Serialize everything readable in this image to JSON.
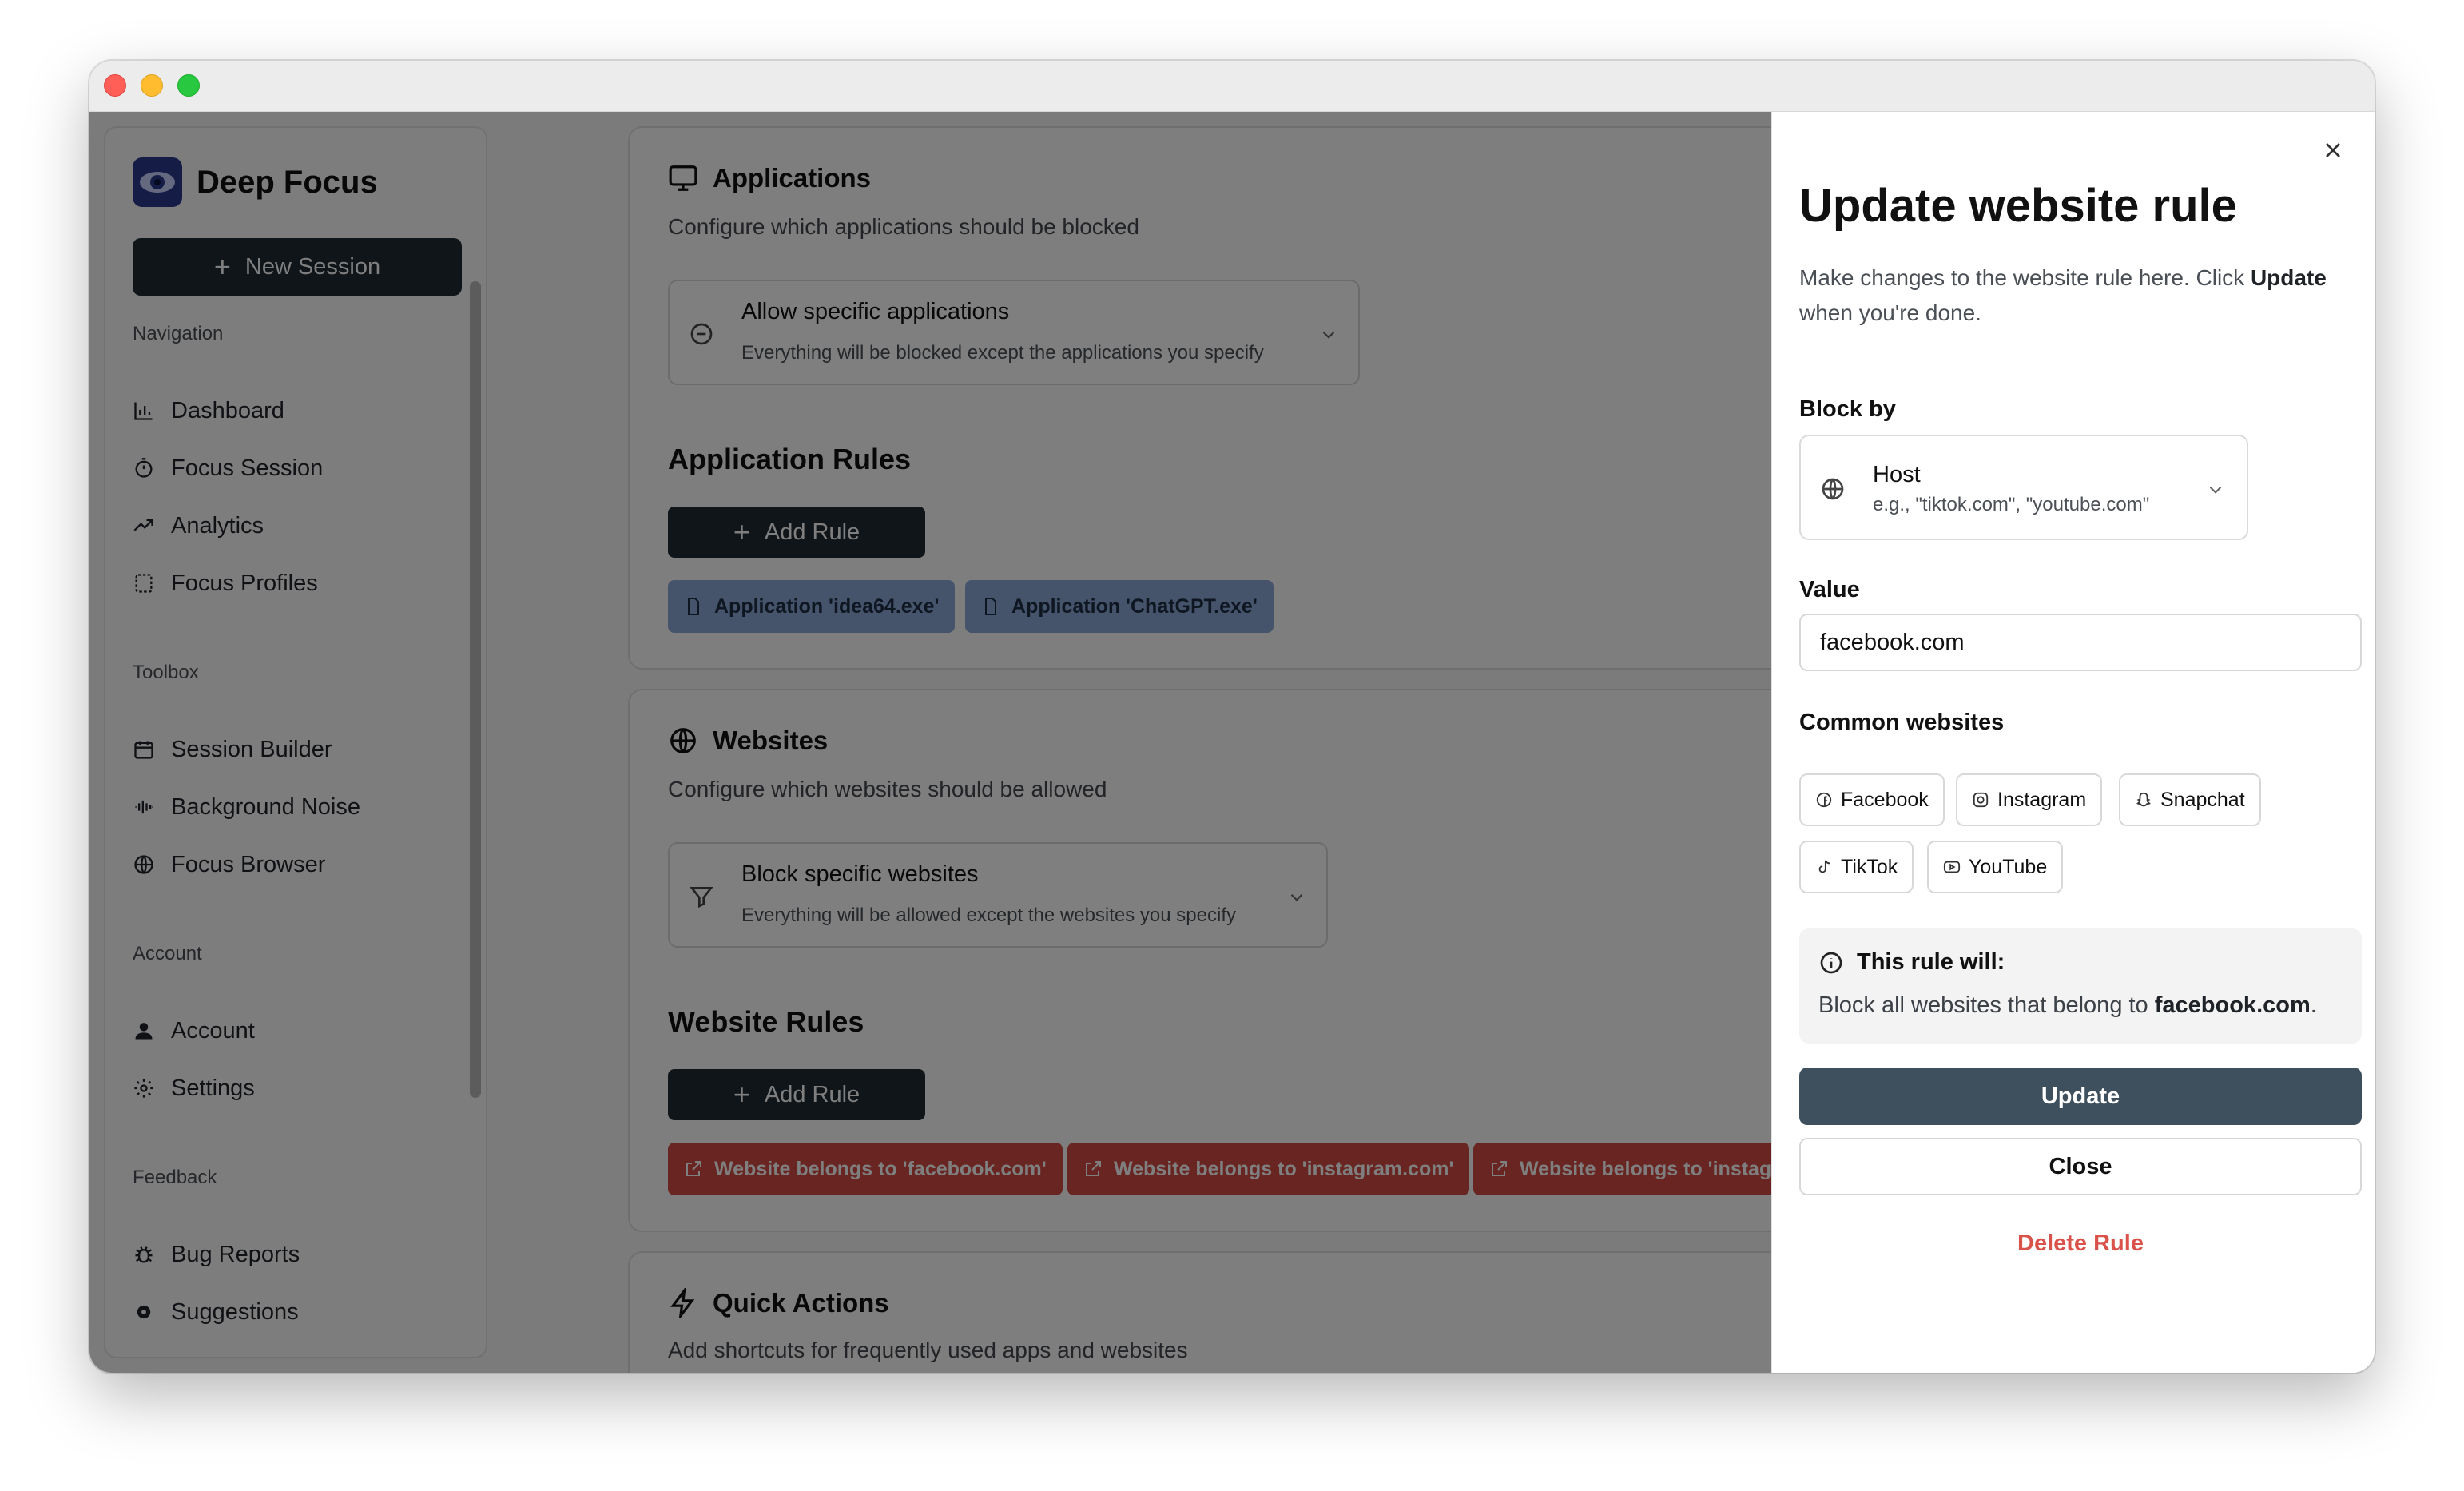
{
  "sidebar": {
    "brand": "Deep Focus",
    "new_session": "New Session",
    "sections": {
      "navigation": "Navigation",
      "toolbox": "Toolbox",
      "account": "Account",
      "feedback": "Feedback"
    },
    "items": {
      "dashboard": "Dashboard",
      "focus_session": "Focus Session",
      "analytics": "Analytics",
      "focus_profiles": "Focus Profiles",
      "session_builder": "Session Builder",
      "background_noise": "Background Noise",
      "focus_browser": "Focus Browser",
      "account": "Account",
      "settings": "Settings",
      "bug_reports": "Bug Reports",
      "suggestions": "Suggestions"
    }
  },
  "applications": {
    "title": "Applications",
    "subtitle": "Configure which applications should be blocked",
    "mode_title": "Allow specific applications",
    "mode_desc": "Everything will be blocked except the applications you specify",
    "rules_title": "Application Rules",
    "add_rule": "Add Rule",
    "rules": [
      "Application 'idea64.exe'",
      "Application 'ChatGPT.exe'"
    ]
  },
  "websites": {
    "title": "Websites",
    "subtitle": "Configure which websites should be allowed",
    "mode_title": "Block specific websites",
    "mode_desc": "Everything will be allowed except the websites you specify",
    "rules_title": "Website Rules",
    "add_rule": "Add Rule",
    "rules": [
      "Website belongs to 'facebook.com'",
      "Website belongs to 'instagram.com'",
      "Website belongs to 'instag"
    ]
  },
  "quick_actions": {
    "title": "Quick Actions",
    "subtitle": "Add shortcuts for frequently used apps and websites"
  },
  "drawer": {
    "title": "Update website rule",
    "desc_prefix": "Make changes to the website rule here. Click ",
    "desc_bold": "Update",
    "desc_suffix": " when you're done.",
    "block_by_label": "Block by",
    "block_by_value": "Host",
    "block_by_hint": "e.g., \"tiktok.com\", \"youtube.com\"",
    "value_label": "Value",
    "value": "facebook.com",
    "common_label": "Common websites",
    "common": [
      "Facebook",
      "Instagram",
      "Snapchat",
      "TikTok",
      "YouTube"
    ],
    "info_title": "This rule will:",
    "info_prefix": "Block all websites that belong to ",
    "info_bold": "facebook.com",
    "info_suffix": ".",
    "update": "Update",
    "close": "Close",
    "delete": "Delete Rule"
  },
  "colors": {
    "primary_dark": "#1e2b33",
    "update_button": "#3e4f5d",
    "danger": "#d9534a",
    "website_chip": "#d14b43",
    "app_chip": "#8aa6d6",
    "brand": "#2b3a8f"
  }
}
